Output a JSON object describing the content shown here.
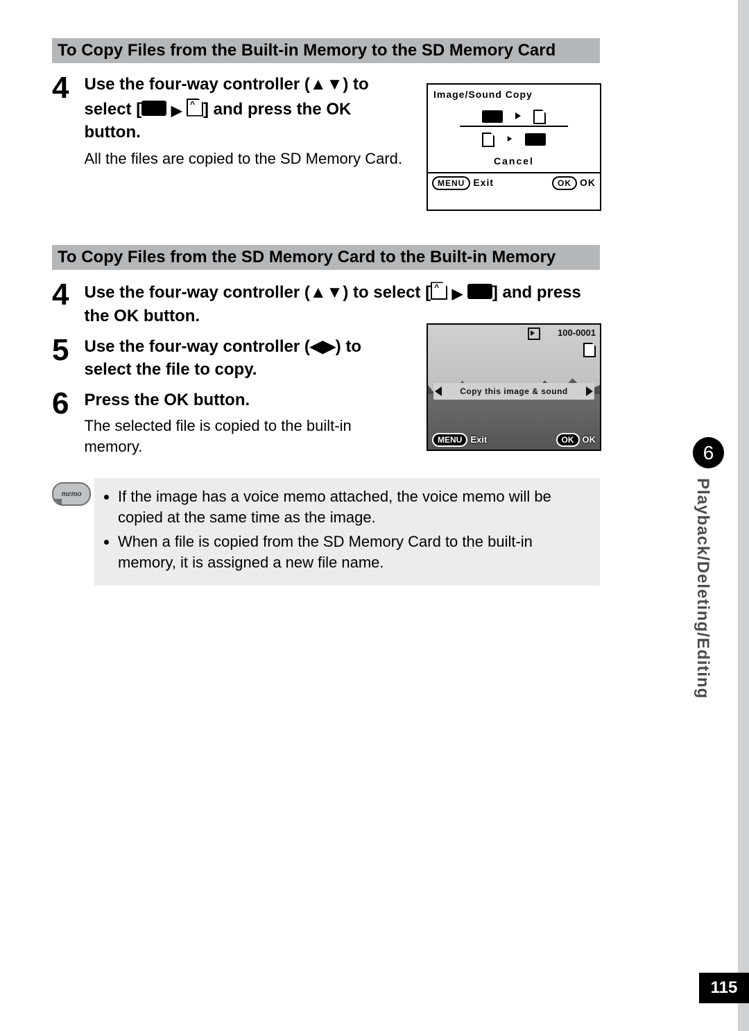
{
  "section1": {
    "heading": "To Copy Files from the Built-in Memory to the SD Memory Card",
    "steps": [
      {
        "num": "4",
        "title_pre": "Use the four-way controller (▲▼) to select ",
        "title_post": " and press the OK button.",
        "desc": "All the files are copied to the SD Memory Card."
      }
    ]
  },
  "section2": {
    "heading": "To Copy Files from the SD Memory Card to the Built-in Memory",
    "steps": [
      {
        "num": "4",
        "title_pre": "Use the four-way controller (▲▼) to select ",
        "title_post": " and press the OK button."
      },
      {
        "num": "5",
        "title": "Use the four-way controller (◀▶) to select the file to copy."
      },
      {
        "num": "6",
        "title": "Press the OK button.",
        "desc": "The selected file is copied to the built-in memory."
      }
    ]
  },
  "memo": {
    "label": "memo",
    "items": [
      "If the image has a voice memo attached, the voice memo will be copied at the same time as the image.",
      "When a file is copied from the SD Memory Card to the built-in memory, it is assigned a new file name."
    ]
  },
  "screen1": {
    "title": "Image/Sound Copy",
    "cancel": "Cancel",
    "menu_btn": "MENU",
    "exit": "Exit",
    "ok_btn": "OK",
    "ok": "OK"
  },
  "screen2": {
    "file_no": "100-0001",
    "band": "Copy this image & sound",
    "menu_btn": "MENU",
    "exit": "Exit",
    "ok_btn": "OK",
    "ok": "OK"
  },
  "sidetab": {
    "chapter": "6",
    "title": "Playback/Deleting/Editing"
  },
  "page_number": "115"
}
